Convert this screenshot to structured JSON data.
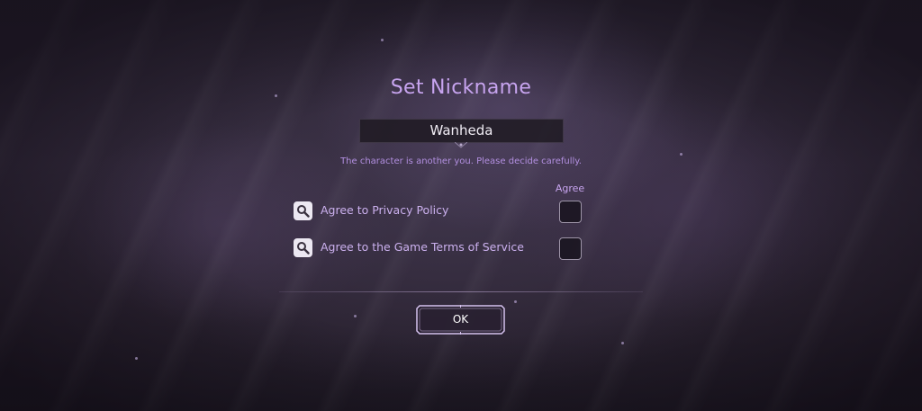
{
  "dialog": {
    "title": "Set Nickname",
    "nickname_value": "Wanheda",
    "hint": "The character is another you. Please decide carefully.",
    "agree_column_header": "Agree",
    "agreements": [
      {
        "label": "Agree to Privacy Policy",
        "checked": false,
        "icon": "magnifier-icon"
      },
      {
        "label": "Agree to the Game Terms of Service",
        "checked": false,
        "icon": "magnifier-icon"
      }
    ],
    "ok_label": "OK"
  },
  "colors": {
    "accent": "#c7a4ef",
    "hint_text": "#b28fe0",
    "button_border": "#d6c3f0"
  }
}
